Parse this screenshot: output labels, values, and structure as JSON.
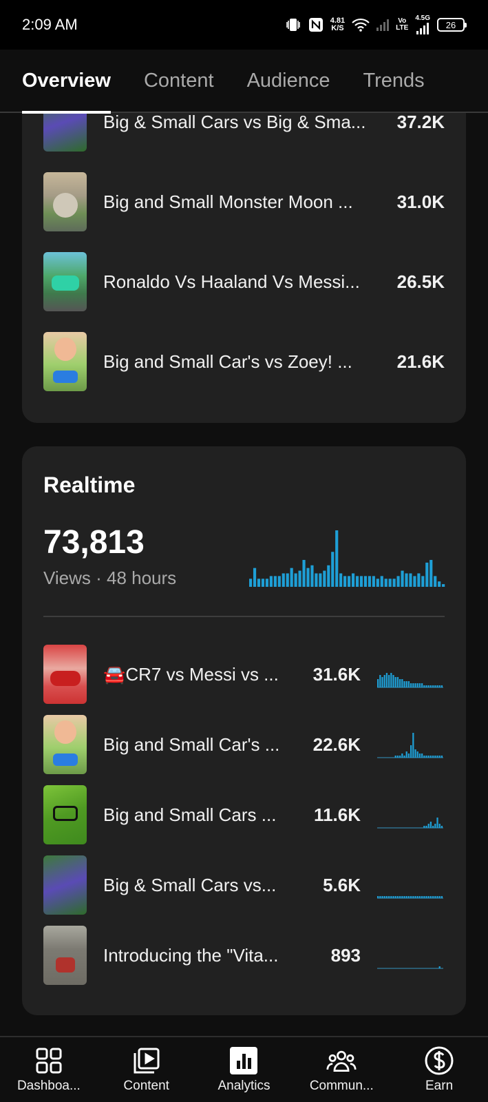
{
  "status": {
    "time": "2:09 AM",
    "speed_value": "4.81",
    "speed_unit": "K/S",
    "network": "4.5G",
    "volte_top": "Vo",
    "volte_bottom": "LTE",
    "battery": "26"
  },
  "tabs": [
    {
      "label": "Overview",
      "active": true
    },
    {
      "label": "Content",
      "active": false
    },
    {
      "label": "Audience",
      "active": false
    },
    {
      "label": "Trends",
      "active": false
    }
  ],
  "top_videos": [
    {
      "title": "Big & Small Cars vs Big & Sma...",
      "value": "37.2K"
    },
    {
      "title": "Big and Small Monster Moon ...",
      "value": "31.0K"
    },
    {
      "title": "Ronaldo Vs Haaland Vs Messi...",
      "value": "26.5K"
    },
    {
      "title": "Big and Small Car's vs Zoey! ...",
      "value": "21.6K"
    }
  ],
  "realtime": {
    "title": "Realtime",
    "views": "73,813",
    "subtitle": "Views · 48 hours",
    "accent": "#1e9fd6",
    "bars": [
      3,
      7,
      3,
      3,
      3,
      4,
      4,
      4,
      5,
      5,
      7,
      5,
      6,
      10,
      7,
      8,
      5,
      5,
      6,
      8,
      13,
      21,
      5,
      4,
      4,
      5,
      4,
      4,
      4,
      4,
      4,
      3,
      4,
      3,
      3,
      3,
      4,
      6,
      5,
      5,
      4,
      5,
      4,
      9,
      10,
      4,
      2,
      1
    ],
    "videos": [
      {
        "title": "🚘CR7 vs Messi vs ...",
        "value": "31.6K",
        "spark": [
          4,
          6,
          5,
          6,
          7,
          6,
          7,
          6,
          5,
          5,
          4,
          4,
          3,
          3,
          3,
          2,
          2,
          2,
          2,
          2,
          2,
          1,
          1,
          1,
          1,
          1,
          1,
          1,
          1,
          1
        ]
      },
      {
        "title": "Big and Small Car's ...",
        "value": "22.6K",
        "spark": [
          0,
          0,
          0,
          0,
          0,
          0,
          0,
          0,
          1,
          1,
          1,
          2,
          1,
          3,
          2,
          6,
          12,
          4,
          3,
          2,
          2,
          1,
          1,
          1,
          1,
          1,
          1,
          1,
          1,
          1
        ]
      },
      {
        "title": "Big and Small Cars ...",
        "value": "11.6K",
        "spark": [
          0,
          0,
          0,
          0,
          0,
          0,
          0,
          0,
          0,
          0,
          0,
          0,
          0,
          0,
          0,
          0,
          0,
          0,
          0,
          0,
          0,
          1,
          1,
          2,
          3,
          1,
          2,
          5,
          2,
          1
        ]
      },
      {
        "title": "Big & Small Cars vs...",
        "value": "5.6K",
        "spark": [
          1,
          1,
          1,
          1,
          1,
          1,
          1,
          1,
          1,
          1,
          1,
          1,
          1,
          1,
          1,
          1,
          1,
          1,
          1,
          1,
          1,
          1,
          1,
          1,
          1,
          1,
          1,
          1,
          1,
          1
        ]
      },
      {
        "title": "Introducing the \"Vita...",
        "value": "893",
        "spark": [
          0,
          0,
          0,
          0,
          0,
          0,
          0,
          0,
          0,
          0,
          0,
          0,
          0,
          0,
          0,
          0,
          0,
          0,
          0,
          0,
          0,
          0,
          0,
          0,
          0,
          0,
          0,
          0,
          1,
          0
        ]
      }
    ]
  },
  "bottom_nav": [
    {
      "label": "Dashboa...",
      "icon": "dashboard-icon"
    },
    {
      "label": "Content",
      "icon": "content-icon"
    },
    {
      "label": "Analytics",
      "icon": "analytics-icon"
    },
    {
      "label": "Commun...",
      "icon": "community-icon"
    },
    {
      "label": "Earn",
      "icon": "earn-icon"
    }
  ]
}
